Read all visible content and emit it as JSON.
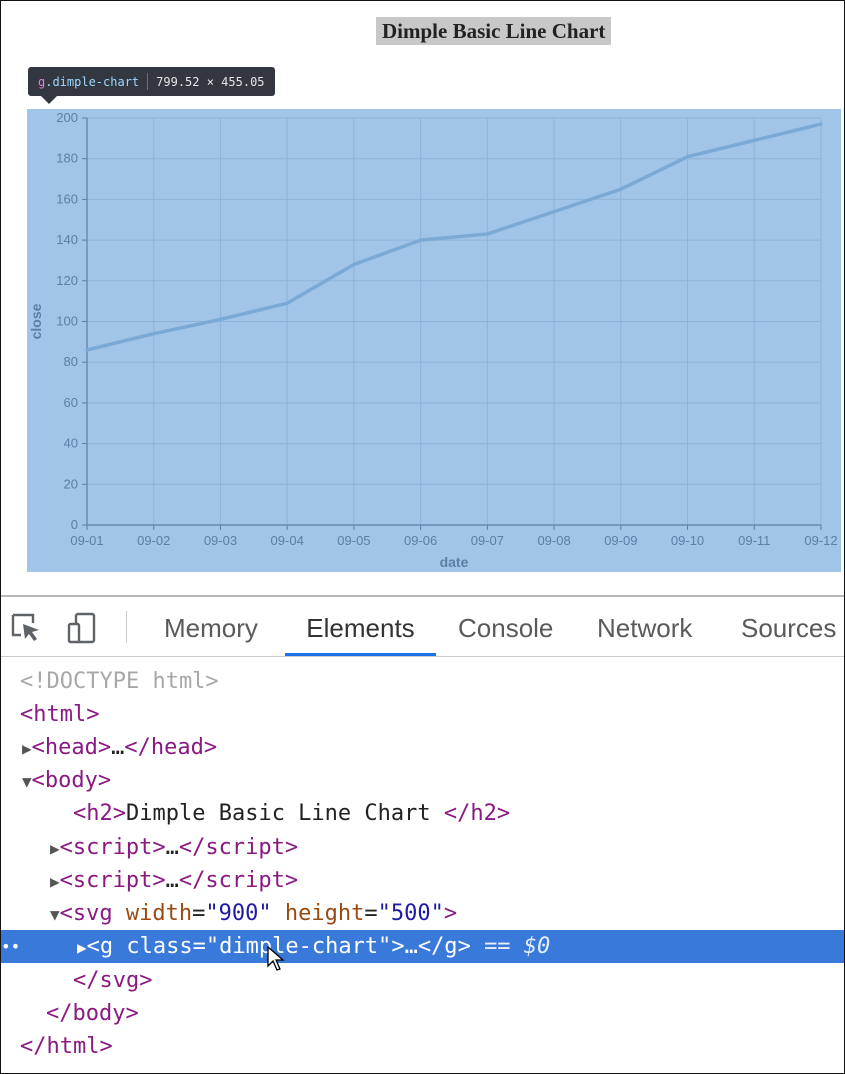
{
  "page": {
    "title": "Dimple Basic Line Chart"
  },
  "tooltip": {
    "tag": "g",
    "class_name": ".dimple-chart",
    "size": "799.52 × 455.05"
  },
  "chart_data": {
    "type": "line",
    "categories": [
      "09-01",
      "09-02",
      "09-03",
      "09-04",
      "09-05",
      "09-06",
      "09-07",
      "09-08",
      "09-09",
      "09-10",
      "09-11",
      "09-12"
    ],
    "series": [
      {
        "values": [
          86,
          94,
          101,
          109,
          128,
          140,
          143,
          154,
          165,
          181,
          189,
          197
        ]
      }
    ],
    "xlabel": "date",
    "ylabel": "close",
    "ylim": [
      0,
      200
    ],
    "yticks": [
      0,
      20,
      40,
      60,
      80,
      100,
      120,
      140,
      160,
      180,
      200
    ],
    "grid": true,
    "line_color": "#7ba9d6"
  },
  "devtools": {
    "tabs": [
      {
        "label": "Memory",
        "active": false
      },
      {
        "label": "Elements",
        "active": true
      },
      {
        "label": "Console",
        "active": false
      },
      {
        "label": "Network",
        "active": false
      },
      {
        "label": "Sources",
        "active": false
      }
    ],
    "tree": {
      "doctype": "<!DOCTYPE html>",
      "html_open": "html",
      "head": {
        "open": "head",
        "ellipsis": "…",
        "close": "/head"
      },
      "body_open": "body",
      "h2": {
        "open": "h2",
        "text": "Dimple Basic Line Chart ",
        "close": "/h2"
      },
      "script1": {
        "open": "script",
        "ellipsis": "…",
        "close": "/script"
      },
      "script2": {
        "open": "script",
        "ellipsis": "…",
        "close": "/script"
      },
      "svg": {
        "tag": "svg",
        "attr1_name": "width",
        "attr1_value": "\"900\"",
        "attr2_name": "height",
        "attr2_value": "\"500\""
      },
      "g": {
        "tag": "g",
        "attr_name": "class",
        "attr_value": "\"dimple-chart\"",
        "ellipsis": "…",
        "close": "/g",
        "marker": "== $0"
      },
      "svg_close": "/svg",
      "body_close": "/body",
      "html_close": "/html"
    }
  }
}
